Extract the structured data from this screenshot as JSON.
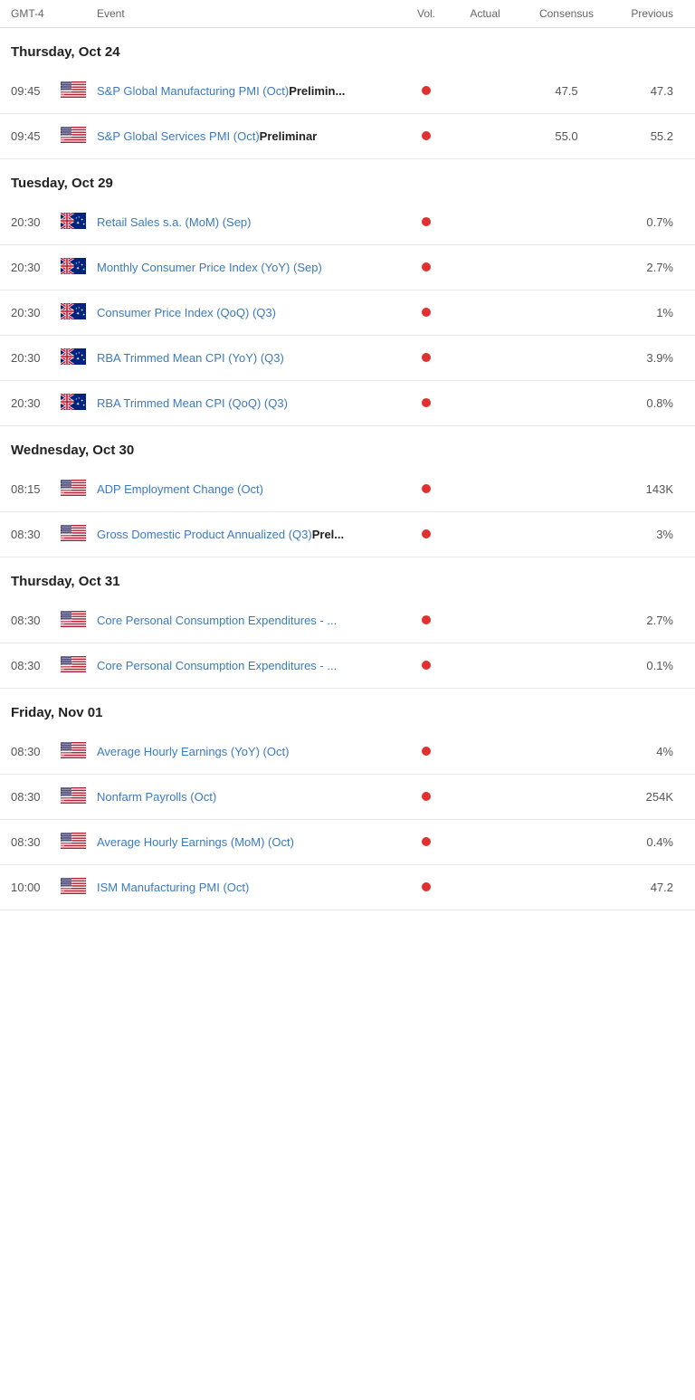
{
  "header": {
    "timezone": "GMT-4",
    "col_event": "Event",
    "col_vol": "Vol.",
    "col_actual": "Actual",
    "col_consensus": "Consensus",
    "col_previous": "Previous"
  },
  "sections": [
    {
      "date": "Thursday, Oct 24",
      "events": [
        {
          "time": "09:45",
          "country": "us",
          "event": "S&P Global Manufacturing PMI (Oct)",
          "tag": "Prelimin...",
          "vol": true,
          "actual": "",
          "consensus": "47.5",
          "previous": "47.3"
        },
        {
          "time": "09:45",
          "country": "us",
          "event": "S&P Global Services PMI (Oct)",
          "tag": "Preliminar",
          "vol": true,
          "actual": "",
          "consensus": "55.0",
          "previous": "55.2"
        }
      ]
    },
    {
      "date": "Tuesday, Oct 29",
      "events": [
        {
          "time": "20:30",
          "country": "au",
          "event": "Retail Sales s.a. (MoM) (Sep)",
          "tag": "",
          "vol": true,
          "actual": "",
          "consensus": "",
          "previous": "0.7%"
        },
        {
          "time": "20:30",
          "country": "au",
          "event": "Monthly Consumer Price Index (YoY) (Sep)",
          "tag": "",
          "vol": true,
          "actual": "",
          "consensus": "",
          "previous": "2.7%"
        },
        {
          "time": "20:30",
          "country": "au",
          "event": "Consumer Price Index (QoQ) (Q3)",
          "tag": "",
          "vol": true,
          "actual": "",
          "consensus": "",
          "previous": "1%"
        },
        {
          "time": "20:30",
          "country": "au",
          "event": "RBA Trimmed Mean CPI (YoY) (Q3)",
          "tag": "",
          "vol": true,
          "actual": "",
          "consensus": "",
          "previous": "3.9%"
        },
        {
          "time": "20:30",
          "country": "au",
          "event": "RBA Trimmed Mean CPI (QoQ) (Q3)",
          "tag": "",
          "vol": true,
          "actual": "",
          "consensus": "",
          "previous": "0.8%"
        }
      ]
    },
    {
      "date": "Wednesday, Oct 30",
      "events": [
        {
          "time": "08:15",
          "country": "us",
          "event": "ADP Employment Change (Oct)",
          "tag": "",
          "vol": true,
          "actual": "",
          "consensus": "",
          "previous": "143K"
        },
        {
          "time": "08:30",
          "country": "us",
          "event": "Gross Domestic Product Annualized (Q3)",
          "tag": "Prel...",
          "vol": true,
          "actual": "",
          "consensus": "",
          "previous": "3%"
        }
      ]
    },
    {
      "date": "Thursday, Oct 31",
      "events": [
        {
          "time": "08:30",
          "country": "us",
          "event": "Core Personal Consumption Expenditures - ...",
          "tag": "",
          "vol": true,
          "actual": "",
          "consensus": "",
          "previous": "2.7%"
        },
        {
          "time": "08:30",
          "country": "us",
          "event": "Core Personal Consumption Expenditures - ...",
          "tag": "",
          "vol": true,
          "actual": "",
          "consensus": "",
          "previous": "0.1%"
        }
      ]
    },
    {
      "date": "Friday, Nov 01",
      "events": [
        {
          "time": "08:30",
          "country": "us",
          "event": "Average Hourly Earnings (YoY) (Oct)",
          "tag": "",
          "vol": true,
          "actual": "",
          "consensus": "",
          "previous": "4%"
        },
        {
          "time": "08:30",
          "country": "us",
          "event": "Nonfarm Payrolls (Oct)",
          "tag": "",
          "vol": true,
          "actual": "",
          "consensus": "",
          "previous": "254K"
        },
        {
          "time": "08:30",
          "country": "us",
          "event": "Average Hourly Earnings (MoM) (Oct)",
          "tag": "",
          "vol": true,
          "actual": "",
          "consensus": "",
          "previous": "0.4%"
        },
        {
          "time": "10:00",
          "country": "us",
          "event": "ISM Manufacturing PMI (Oct)",
          "tag": "",
          "vol": true,
          "actual": "",
          "consensus": "",
          "previous": "47.2"
        }
      ]
    }
  ]
}
